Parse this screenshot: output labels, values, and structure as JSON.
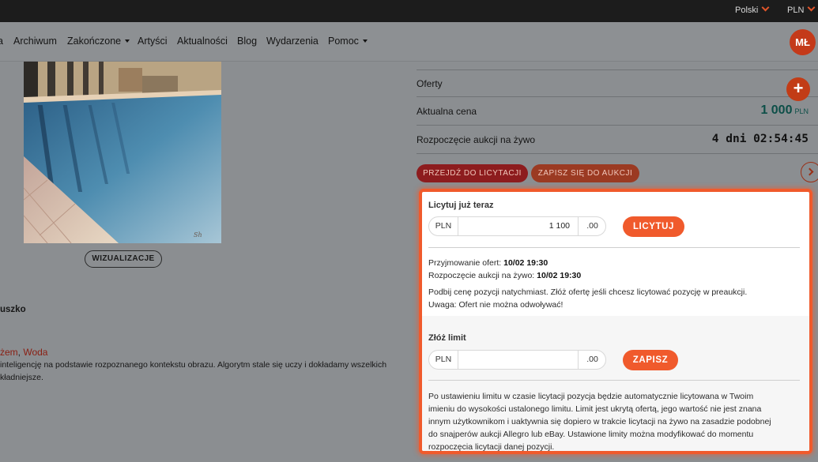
{
  "topbar": {
    "language": "Polski",
    "currency": "PLN"
  },
  "nav": {
    "items": [
      "a",
      "Archiwum",
      "Zakończone",
      "Artyści",
      "Aktualności",
      "Blog",
      "Wydarzenia",
      "Pomoc"
    ],
    "avatar_initials": "MŁ"
  },
  "artwork": {
    "visualizations_button": "WIZUALIZACJE",
    "artist_partial": "uszko",
    "tag_partial": "żem",
    "tag_separator": ", ",
    "tag_water": "Woda",
    "description_line1": "inteligencję na podstawie rozpoznanego kontekstu obrazu. Algorytm stale się uczy i dokładamy wszelkich",
    "description_line2": "kładniejsze."
  },
  "auction": {
    "offers_label": "Oferty",
    "current_price_label": "Aktualna cena",
    "current_price_value": "1 000",
    "current_price_currency": "PLN",
    "live_start_label": "Rozpoczęcie aukcji na żywo",
    "countdown": "4 dni 02:54:45",
    "go_to_bidding_button": "PRZEJDŹ DO LICYTACJI",
    "register_button": "ZAPISZ SIĘ DO AUKCJI"
  },
  "bid_panel": {
    "bid_now_title": "Licytuj już teraz",
    "currency": "PLN",
    "bid_value": "1 100",
    "decimals": ".00",
    "bid_button": "LICYTUJ",
    "accepting_label": "Przyjmowanie ofert: ",
    "accepting_value": "10/02 19:30",
    "live_label": "Rozpoczęcie aukcji na żywo: ",
    "live_value": "10/02 19:30",
    "info_line1": "Podbij cenę pozycji natychmiast. Złóż ofertę jeśli chcesz licytować pozycję w preaukcji.",
    "info_line2": "Uwaga: Ofert nie można odwoływać!",
    "limit_title": "Złóż limit",
    "limit_value": "",
    "limit_decimals": ".00",
    "save_button": "ZAPISZ",
    "limit_info_lines": [
      "Po ustawieniu limitu w czasie licytacji pozycja będzie automatycznie licytowana w Twoim",
      "imieniu do wysokości ustalonego limitu. Limit jest ukrytą ofertą, jego wartość nie jest znana",
      "innym użytkownikom i uaktywnia się dopiero w trakcie licytacji na żywo na zasadzie podobnej",
      "do snajperów aukcji Allegro lub eBay. Ustawione limity można modyfikować do momentu",
      "rozpoczęcia licytacji danej pozycji."
    ]
  },
  "colors": {
    "accent": "#f05a2c",
    "price": "#0d4f48",
    "overlay": "#8b8e91"
  },
  "icons": [
    "chevron-down-icon",
    "plus-icon",
    "chevron-right-icon"
  ]
}
